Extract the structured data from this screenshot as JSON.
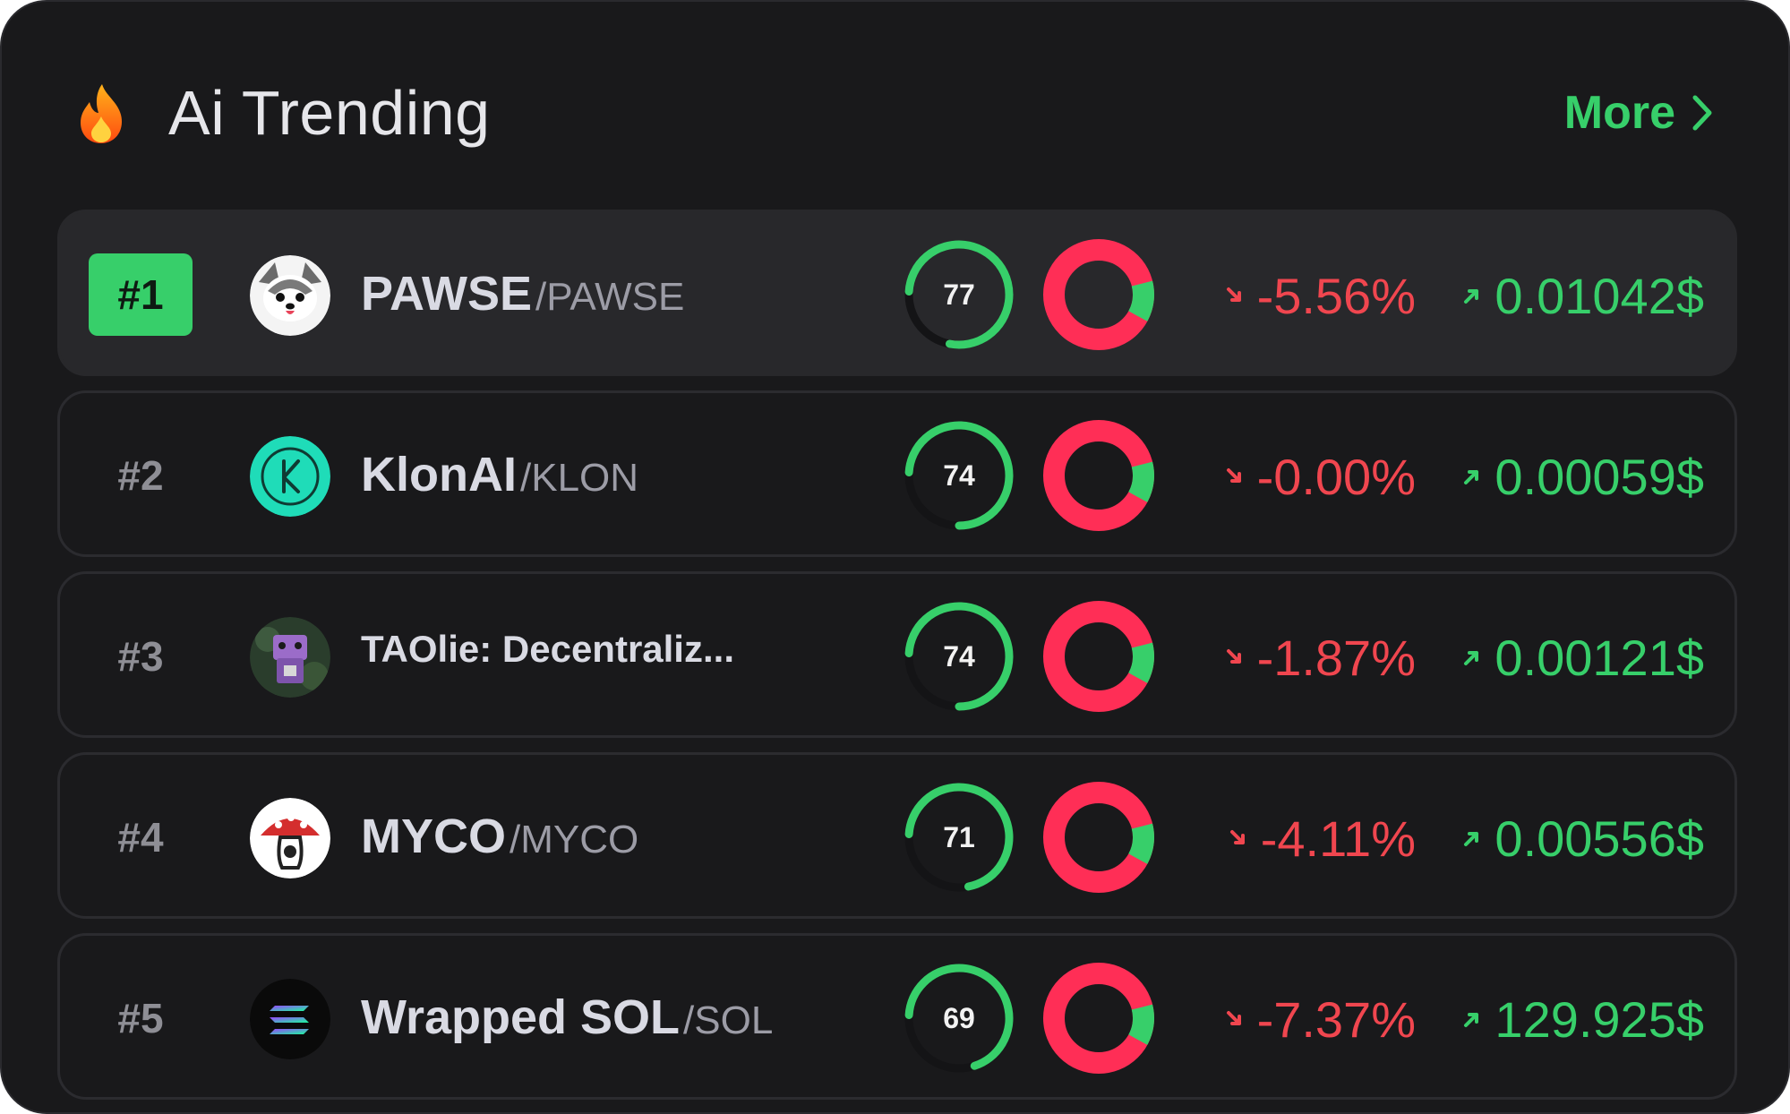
{
  "header": {
    "title": "Ai Trending",
    "more_label": "More",
    "fire_icon": "fire-icon",
    "more_icon": "chevron-right-icon"
  },
  "colors": {
    "background": "#19191b",
    "accent_green": "#37cf6a",
    "negative_red": "#f0464f",
    "donut_red": "#ff2e56"
  },
  "rows": [
    {
      "rank": "#1",
      "name": "PAWSE",
      "symbol": "PAWSE",
      "score": "77",
      "score_frac": 0.77,
      "donut_green_frac": 0.12,
      "change": "-5.56%",
      "price": "0.01042$",
      "avatar": "pawse-dog-avatar",
      "active": true
    },
    {
      "rank": "#2",
      "name": "KlonAI",
      "symbol": "KLON",
      "score": "74",
      "score_frac": 0.74,
      "donut_green_frac": 0.12,
      "change": "-0.00%",
      "price": "0.00059$",
      "avatar": "klon-k-logo",
      "active": false
    },
    {
      "rank": "#3",
      "name": "TAOlie: Decentraliz...",
      "symbol": "",
      "score": "74",
      "score_frac": 0.74,
      "donut_green_frac": 0.12,
      "change": "-1.87%",
      "price": "0.00121$",
      "avatar": "taolie-purple-avatar",
      "active": false
    },
    {
      "rank": "#4",
      "name": "MYCO",
      "symbol": "MYCO",
      "score": "71",
      "score_frac": 0.71,
      "donut_green_frac": 0.12,
      "change": "-4.11%",
      "price": "0.00556$",
      "avatar": "myco-mushroom-logo",
      "active": false
    },
    {
      "rank": "#5",
      "name": "Wrapped SOL",
      "symbol": "SOL",
      "score": "69",
      "score_frac": 0.69,
      "donut_green_frac": 0.12,
      "change": "-7.37%",
      "price": "129.925$",
      "avatar": "solana-logo",
      "active": false
    }
  ]
}
